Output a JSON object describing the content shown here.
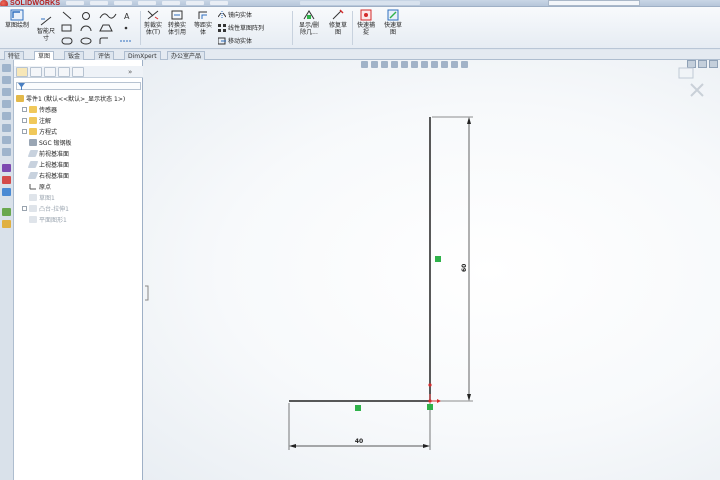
{
  "app": {
    "logo_text": "SOLIDWORKS"
  },
  "ribbon": {
    "sketch_button": "草图绘制",
    "smart_dim_line1": "智能尺",
    "smart_dim_line2": "寸",
    "trim_line1": "剪裁实",
    "trim_line2": "体(T)",
    "convert_line1": "转换实",
    "convert_line2": "体引用",
    "offset_line1": "等距实",
    "offset_line2": "体",
    "mirror": "镜向实体",
    "linear_pattern": "线性草图阵列",
    "move": "移动实体",
    "display_delete_line1": "显示/删",
    "display_delete_line2": "除几...",
    "repair_line1": "修复草",
    "repair_line2": "图",
    "quick_snap_line1": "快速捕",
    "quick_snap_line2": "捉",
    "rapid_sketch_line1": "快速草",
    "rapid_sketch_line2": "图"
  },
  "tabs": [
    {
      "label": "特征"
    },
    {
      "label": "草图"
    },
    {
      "label": "钣金"
    },
    {
      "label": "评估"
    },
    {
      "label": "DimXpert"
    },
    {
      "label": "办公室产品"
    }
  ],
  "tree": {
    "root": "零件1 (默认<<默认>_显示状态 1>)",
    "items": [
      {
        "label": "传感器"
      },
      {
        "label": "注解"
      },
      {
        "label": "方程式"
      },
      {
        "label": "SGC 锻钢板"
      },
      {
        "label": "前视基准面"
      },
      {
        "label": "上视基准面"
      },
      {
        "label": "右视基准面"
      },
      {
        "label": "原点"
      },
      {
        "label": "草图1"
      },
      {
        "label": "凸台-拉伸1"
      },
      {
        "label": "平面图形1"
      }
    ]
  },
  "sketch": {
    "horizontal_dimension": "40",
    "vertical_dimension": "60"
  },
  "colors": {
    "accent": "#2f6fbf",
    "sketch_line": "#222222",
    "relation": "#2fb24a",
    "endpoint": "#d42b2b"
  }
}
